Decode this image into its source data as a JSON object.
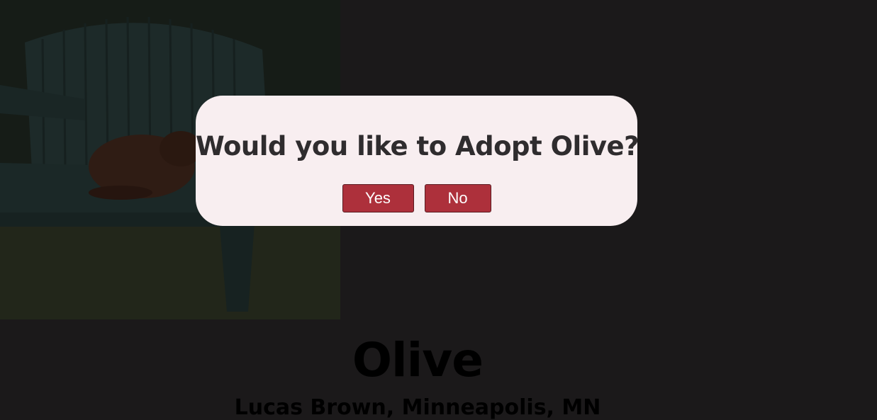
{
  "profile": {
    "name": "Olive",
    "location": "Lucas Brown, Minneapolis, MN"
  },
  "dialog": {
    "title": "Would you like to Adopt Olive?",
    "yes_label": "Yes",
    "no_label": "No"
  },
  "colors": {
    "backdrop": "#1b191a",
    "modal_bg": "#f8eef0",
    "button_bg": "#ad303b",
    "title_text": "#2f2c2e"
  }
}
